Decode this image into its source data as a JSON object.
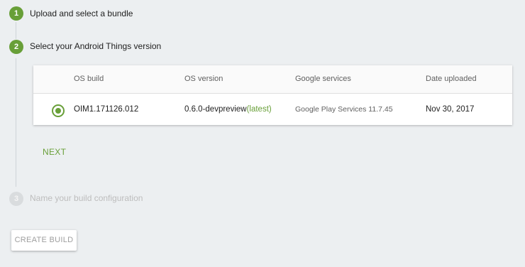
{
  "steps": [
    {
      "number": "1",
      "title": "Upload and select a bundle",
      "state": "done"
    },
    {
      "number": "2",
      "title": "Select your Android Things version",
      "state": "active"
    },
    {
      "number": "3",
      "title": "Name your build configuration",
      "state": "pending"
    }
  ],
  "table": {
    "headers": [
      "OS build",
      "OS version",
      "Google services",
      "Date uploaded"
    ],
    "rows": [
      {
        "selected": true,
        "os_build": "OIM1.171126.012",
        "os_version": "0.6.0-devpreview",
        "os_version_tag": "(latest)",
        "google_services": "Google Play Services 11.7.45",
        "date_uploaded": "Nov 30, 2017"
      }
    ]
  },
  "buttons": {
    "next": "NEXT",
    "create_build": "CREATE BUILD"
  },
  "colors": {
    "accent": "#689f38",
    "background": "#eceff1",
    "disabled_text": "#bdbdbd"
  }
}
